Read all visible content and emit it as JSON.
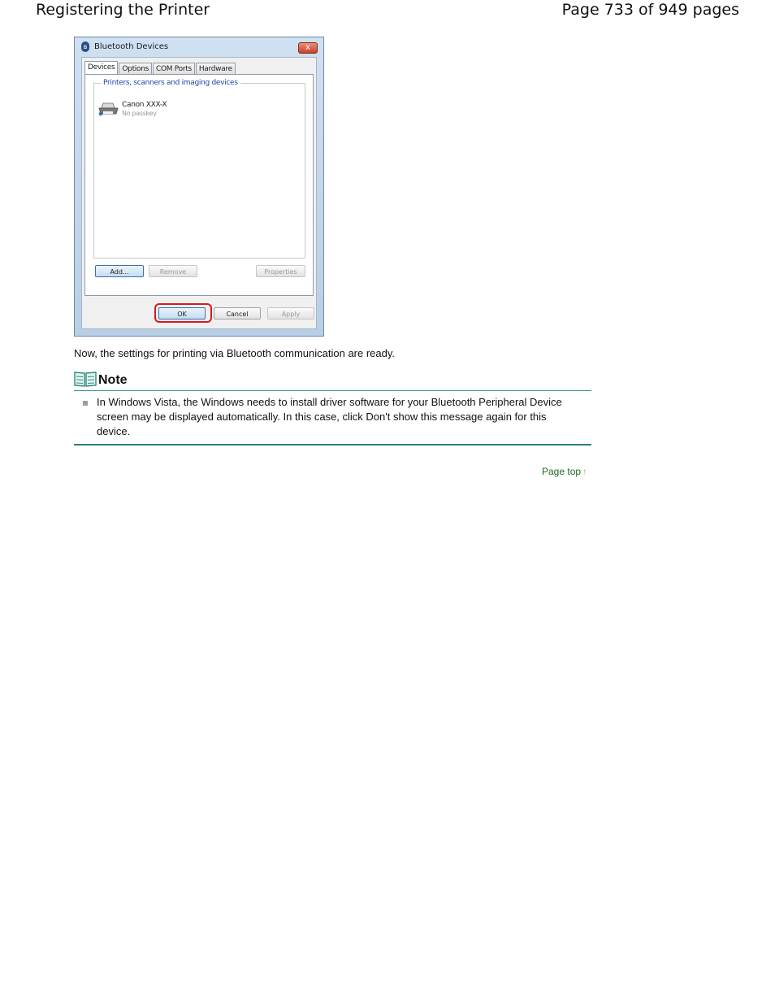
{
  "header": {
    "title": "Registering the Printer",
    "page_info": "Page 733 of 949 pages"
  },
  "dialog": {
    "title": "Bluetooth Devices",
    "close_label": "x",
    "tabs": [
      "Devices",
      "Options",
      "COM Ports",
      "Hardware"
    ],
    "group_title": "Printers, scanners and imaging devices",
    "device": {
      "name": "Canon XXX-X",
      "status": "No passkey"
    },
    "buttons": {
      "add": "Add...",
      "remove": "Remove",
      "properties": "Properties",
      "ok": "OK",
      "cancel": "Cancel",
      "apply": "Apply"
    }
  },
  "body": {
    "paragraph": "Now, the settings for printing via Bluetooth communication are ready."
  },
  "note": {
    "title": "Note",
    "icon": "book-icon",
    "items": [
      "In Windows Vista, the Windows needs to install driver software for your Bluetooth Peripheral Device screen may be displayed automatically. In this case, click Don't show this message again for this device."
    ]
  },
  "footer": {
    "page_top": "Page top",
    "arrow": "↑"
  },
  "colors": {
    "note_rule": "#2e7f74",
    "page_top_link": "#1b6a24",
    "highlight_ring": "#d81a1a"
  }
}
